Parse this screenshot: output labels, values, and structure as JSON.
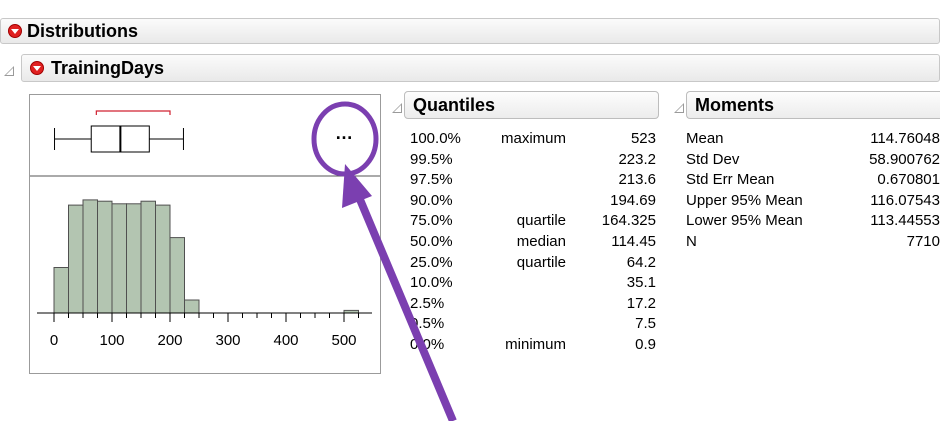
{
  "distributions": {
    "title": "Distributions"
  },
  "variable": {
    "title": "TrainingDays"
  },
  "plot": {
    "menu_label": "…",
    "axis_ticks": [
      "0",
      "100",
      "200",
      "300",
      "400",
      "500"
    ]
  },
  "chart_data": {
    "type": "bar",
    "title": "",
    "xlabel": "",
    "ylabel": "",
    "xlim": [
      -30,
      550
    ],
    "bin_width": 25,
    "bins": [
      {
        "x0": 0,
        "x1": 25,
        "height": 0.35
      },
      {
        "x0": 25,
        "x1": 50,
        "height": 0.83
      },
      {
        "x0": 50,
        "x1": 75,
        "height": 0.87
      },
      {
        "x0": 75,
        "x1": 100,
        "height": 0.86
      },
      {
        "x0": 100,
        "x1": 125,
        "height": 0.84
      },
      {
        "x0": 125,
        "x1": 150,
        "height": 0.84
      },
      {
        "x0": 150,
        "x1": 175,
        "height": 0.86
      },
      {
        "x0": 175,
        "x1": 200,
        "height": 0.83
      },
      {
        "x0": 200,
        "x1": 225,
        "height": 0.58
      },
      {
        "x0": 225,
        "x1": 250,
        "height": 0.1
      },
      {
        "x0": 500,
        "x1": 525,
        "height": 0.02
      }
    ],
    "boxplot": {
      "min": 0.9,
      "q1": 64.2,
      "median": 114.45,
      "q3": 164.325,
      "max": 223.2,
      "short_bracket": [
        73,
        200
      ]
    }
  },
  "quantiles": {
    "title": "Quantiles",
    "rows": [
      {
        "pct": "100.0%",
        "label": "maximum",
        "value": "523"
      },
      {
        "pct": "99.5%",
        "label": "",
        "value": "223.2"
      },
      {
        "pct": "97.5%",
        "label": "",
        "value": "213.6"
      },
      {
        "pct": "90.0%",
        "label": "",
        "value": "194.69"
      },
      {
        "pct": "75.0%",
        "label": "quartile",
        "value": "164.325"
      },
      {
        "pct": "50.0%",
        "label": "median",
        "value": "114.45"
      },
      {
        "pct": "25.0%",
        "label": "quartile",
        "value": "64.2"
      },
      {
        "pct": "10.0%",
        "label": "",
        "value": "35.1"
      },
      {
        "pct": "2.5%",
        "label": "",
        "value": "17.2"
      },
      {
        "pct": "0.5%",
        "label": "",
        "value": "7.5"
      },
      {
        "pct": "0.0%",
        "label": "minimum",
        "value": "0.9"
      }
    ]
  },
  "moments": {
    "title": "Moments",
    "rows": [
      {
        "label": "Mean",
        "value": "114.76048"
      },
      {
        "label": "Std Dev",
        "value": "58.900762"
      },
      {
        "label": "Std Err Mean",
        "value": "0.670801"
      },
      {
        "label": "Upper 95% Mean",
        "value": "116.07543"
      },
      {
        "label": "Lower 95% Mean",
        "value": "113.44553"
      },
      {
        "label": "N",
        "value": "7710"
      }
    ]
  },
  "annotation": {
    "color": "#7b3fb0"
  }
}
